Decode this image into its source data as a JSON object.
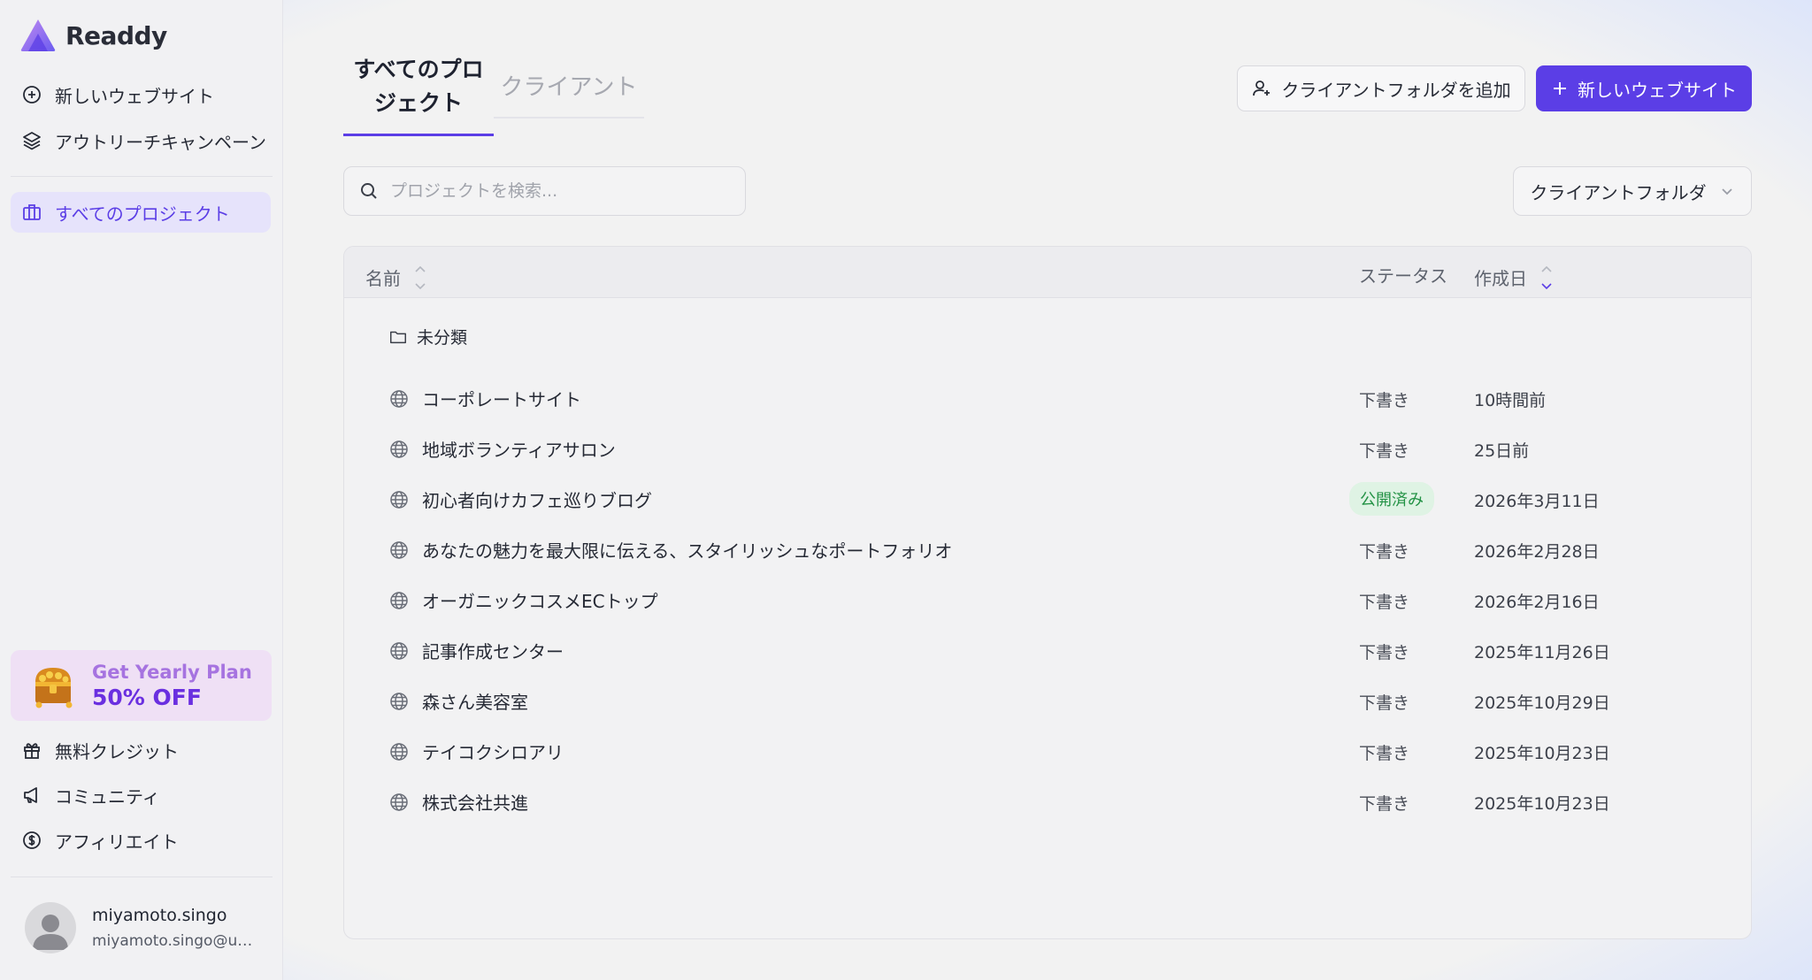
{
  "app": {
    "name": "Readdy"
  },
  "sidebar": {
    "top_items": [
      {
        "label": "新しいウェブサイト",
        "icon": "plus-circle-icon"
      },
      {
        "label": "アウトリーチキャンペーン",
        "icon": "layers-icon"
      }
    ],
    "active_item": {
      "label": "すべてのプロジェクト",
      "icon": "briefcase-icon"
    },
    "promo": {
      "line1": "Get Yearly Plan",
      "line2": "50% OFF",
      "icon": "treasure-chest-icon"
    },
    "bottom_items": [
      {
        "label": "無料クレジット",
        "icon": "gift-icon"
      },
      {
        "label": "コミュニティ",
        "icon": "megaphone-icon"
      },
      {
        "label": "アフィリエイト",
        "icon": "dollar-circle-icon"
      }
    ],
    "user": {
      "name": "miyamoto.singo",
      "email": "miyamoto.singo@unit..."
    }
  },
  "main": {
    "tabs": [
      {
        "label": "すべてのプロジェクト",
        "active": true
      },
      {
        "label": "クライアント",
        "active": false
      }
    ],
    "add_folder_button": "クライアントフォルダを追加",
    "new_site_button": "新しいウェブサイト",
    "search": {
      "placeholder": "プロジェクトを検索..."
    },
    "filter_select": "クライアントフォルダ",
    "table": {
      "columns": {
        "name": "名前",
        "status": "ステータス",
        "created": "作成日"
      },
      "group": "未分類",
      "rows": [
        {
          "name": "コーポレートサイト",
          "status": "下書き",
          "date": "10時間前"
        },
        {
          "name": "地域ボランティアサロン",
          "status": "下書き",
          "date": "25日前"
        },
        {
          "name": "初心者向けカフェ巡りブログ",
          "status": "公開済み",
          "date": "2026年3月11日"
        },
        {
          "name": "あなたの魅力を最大限に伝える、スタイリッシュなポートフォリオ",
          "status": "下書き",
          "date": "2026年2月28日"
        },
        {
          "name": "オーガニックコスメECトップ",
          "status": "下書き",
          "date": "2026年2月16日"
        },
        {
          "name": "記事作成センター",
          "status": "下書き",
          "date": "2025年11月26日"
        },
        {
          "name": "森さん美容室",
          "status": "下書き",
          "date": "2025年10月29日"
        },
        {
          "name": "テイコクシロアリ",
          "status": "下書き",
          "date": "2025年10月23日"
        },
        {
          "name": "株式会社共進",
          "status": "下書き",
          "date": "2025年10月23日"
        }
      ]
    }
  },
  "colors": {
    "accent": "#5b3ee6",
    "published_bg": "#dff3e4",
    "published_text": "#239245"
  }
}
